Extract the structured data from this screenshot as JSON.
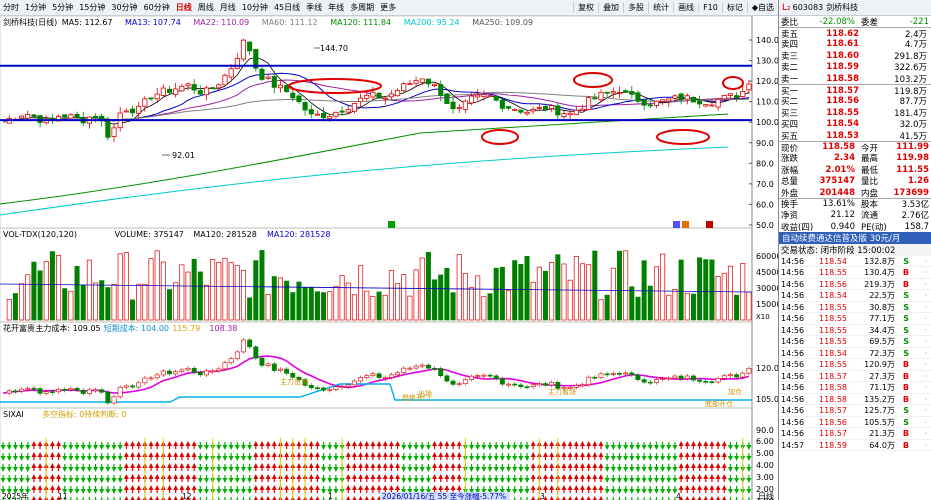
{
  "toolbar": {
    "periods": [
      "分时",
      "1分钟",
      "5分钟",
      "15分钟",
      "30分钟",
      "60分钟",
      "日线",
      "周线",
      "月线",
      "10分钟",
      "45日线",
      "季线",
      "年线",
      "多周期",
      "更多"
    ],
    "active": "日线",
    "tools": [
      "复权",
      "叠加",
      "多股",
      "统计",
      "画线",
      "F10",
      "标记",
      "◆自选"
    ]
  },
  "main": {
    "title": "剑桥科技(日线)",
    "ma": [
      {
        "l": "MA5: 112.67",
        "c": "#000000"
      },
      {
        "l": "MA13: 107.74",
        "c": "#0000d0"
      },
      {
        "l": "MA22: 110.09",
        "c": "#a020a0"
      },
      {
        "l": "MA60: 111.12",
        "c": "#808080"
      },
      {
        "l": "MA120: 111.84",
        "c": "#009000"
      },
      {
        "l": "MA200: 95.24",
        "c": "#00c8c8"
      },
      {
        "l": "MA250: 109.09",
        "c": "#555555"
      }
    ],
    "yticks": [
      "140.0",
      "130.0",
      "120.0",
      "110.0",
      "100.0",
      "90.0",
      "80.0",
      "70.0",
      "60.0",
      "50.0"
    ],
    "high": "144.70",
    "low": "92.01",
    "line_high": "127.5",
    "line_low": "101.0"
  },
  "vol": {
    "title": "VOL-TDX(120,120)",
    "items": [
      {
        "l": "VOLUME: 375147",
        "c": "#000"
      },
      {
        "l": "MA120: 281528",
        "c": "#000"
      },
      {
        "l": "MA120: 281528",
        "c": "#0000d0"
      }
    ],
    "yticks": [
      "60000",
      "45000",
      "30000",
      "15000"
    ],
    "unit": "X10"
  },
  "ind": {
    "title": "花开富贵",
    "items": [
      {
        "l": "主力成本: 109.05",
        "c": "#000"
      },
      {
        "l": "短期成本: 104.00",
        "c": "#1090d0"
      },
      {
        "l": "115.79",
        "c": "#e0a000"
      },
      {
        "l": "108.38",
        "c": "#a020a0"
      }
    ],
    "yticks": [
      "120.0",
      "105.0",
      "90.0"
    ],
    "labels": [
      "主力出货",
      "出场",
      "趋势开门",
      "主力看涨",
      "加仓",
      "底部开仓"
    ]
  },
  "six": {
    "title": "SIXAI",
    "items": [
      {
        "l": "多空指标: 0",
        "c": "#d0a000"
      },
      {
        "l": "持续判断: 0",
        "c": "#d0a000"
      }
    ],
    "yticks": [
      "6.00",
      "5.00",
      "4.00",
      "3.00",
      "2.00",
      "1.00"
    ]
  },
  "xaxis": {
    "labels": [
      "2025年",
      "11",
      "12",
      "1",
      "2026/01/16/五 55 至今涨幅-5.77%",
      "3",
      "4"
    ],
    "end": "日线"
  },
  "quote": {
    "code": "603083",
    "name": "剑桥科技",
    "wb": "-22.08%",
    "wc": "-221",
    "asks": [
      {
        "l": "卖五",
        "p": "118.62",
        "v": "2.4万"
      },
      {
        "l": "卖四",
        "p": "118.61",
        "v": "4.7万"
      },
      {
        "l": "卖三",
        "p": "118.60",
        "v": "291.8万"
      },
      {
        "l": "卖二",
        "p": "118.59",
        "v": "322.6万"
      },
      {
        "l": "卖一",
        "p": "118.58",
        "v": "103.2万"
      }
    ],
    "bids": [
      {
        "l": "买一",
        "p": "118.57",
        "v": "119.8万"
      },
      {
        "l": "买二",
        "p": "118.56",
        "v": "87.7万"
      },
      {
        "l": "买三",
        "p": "118.55",
        "v": "181.4万"
      },
      {
        "l": "买四",
        "p": "118.54",
        "v": "32.0万"
      },
      {
        "l": "买五",
        "p": "118.53",
        "v": "41.5万"
      }
    ],
    "stats": [
      [
        "现价",
        "118.58",
        "今开",
        "111.99"
      ],
      [
        "涨跌",
        "2.34",
        "最高",
        "119.98"
      ],
      [
        "涨幅",
        "2.01%",
        "最低",
        "111.55"
      ],
      [
        "总量",
        "375147",
        "量比",
        "1.26"
      ],
      [
        "外盘",
        "201448",
        "内盘",
        "173699"
      ]
    ],
    "stats2": [
      [
        "换手",
        "13.61%",
        "股本",
        "3.53亿"
      ],
      [
        "净资",
        "21.12",
        "流通",
        "2.76亿"
      ],
      [
        "收益(四)",
        "0.940",
        "PE(动)",
        "158.7"
      ]
    ],
    "ad": "自动续费通达信普及版 30元/月",
    "status": "交易状态: 闭市阶段 15:00:02",
    "ticks": [
      [
        "14:56",
        "118.54",
        "132.8万",
        "S"
      ],
      [
        "14:56",
        "118.55",
        "130.4万",
        "B"
      ],
      [
        "14:56",
        "118.56",
        "219.3万",
        "B"
      ],
      [
        "14:56",
        "118.54",
        "22.5万",
        "S"
      ],
      [
        "14:56",
        "118.55",
        "30.8万",
        "S"
      ],
      [
        "14:56",
        "118.55",
        "77.1万",
        "S"
      ],
      [
        "14:56",
        "118.55",
        "34.4万",
        "S"
      ],
      [
        "14:56",
        "118.55",
        "69.5万",
        "S"
      ],
      [
        "14:56",
        "118.54",
        "72.3万",
        "S"
      ],
      [
        "14:56",
        "118.55",
        "120.9万",
        "B"
      ],
      [
        "14:56",
        "118.57",
        "27.3万",
        "B"
      ],
      [
        "14:56",
        "118.58",
        "71.1万",
        "B"
      ],
      [
        "14:56",
        "118.58",
        "135.2万",
        "B"
      ],
      [
        "14:56",
        "118.57",
        "125.7万",
        "S"
      ],
      [
        "14:56",
        "118.56",
        "105.5万",
        "S"
      ],
      [
        "14:56",
        "118.57",
        "21.3万",
        "B"
      ],
      [
        "14:57",
        "118.59",
        "64.0万",
        "B"
      ]
    ]
  }
}
